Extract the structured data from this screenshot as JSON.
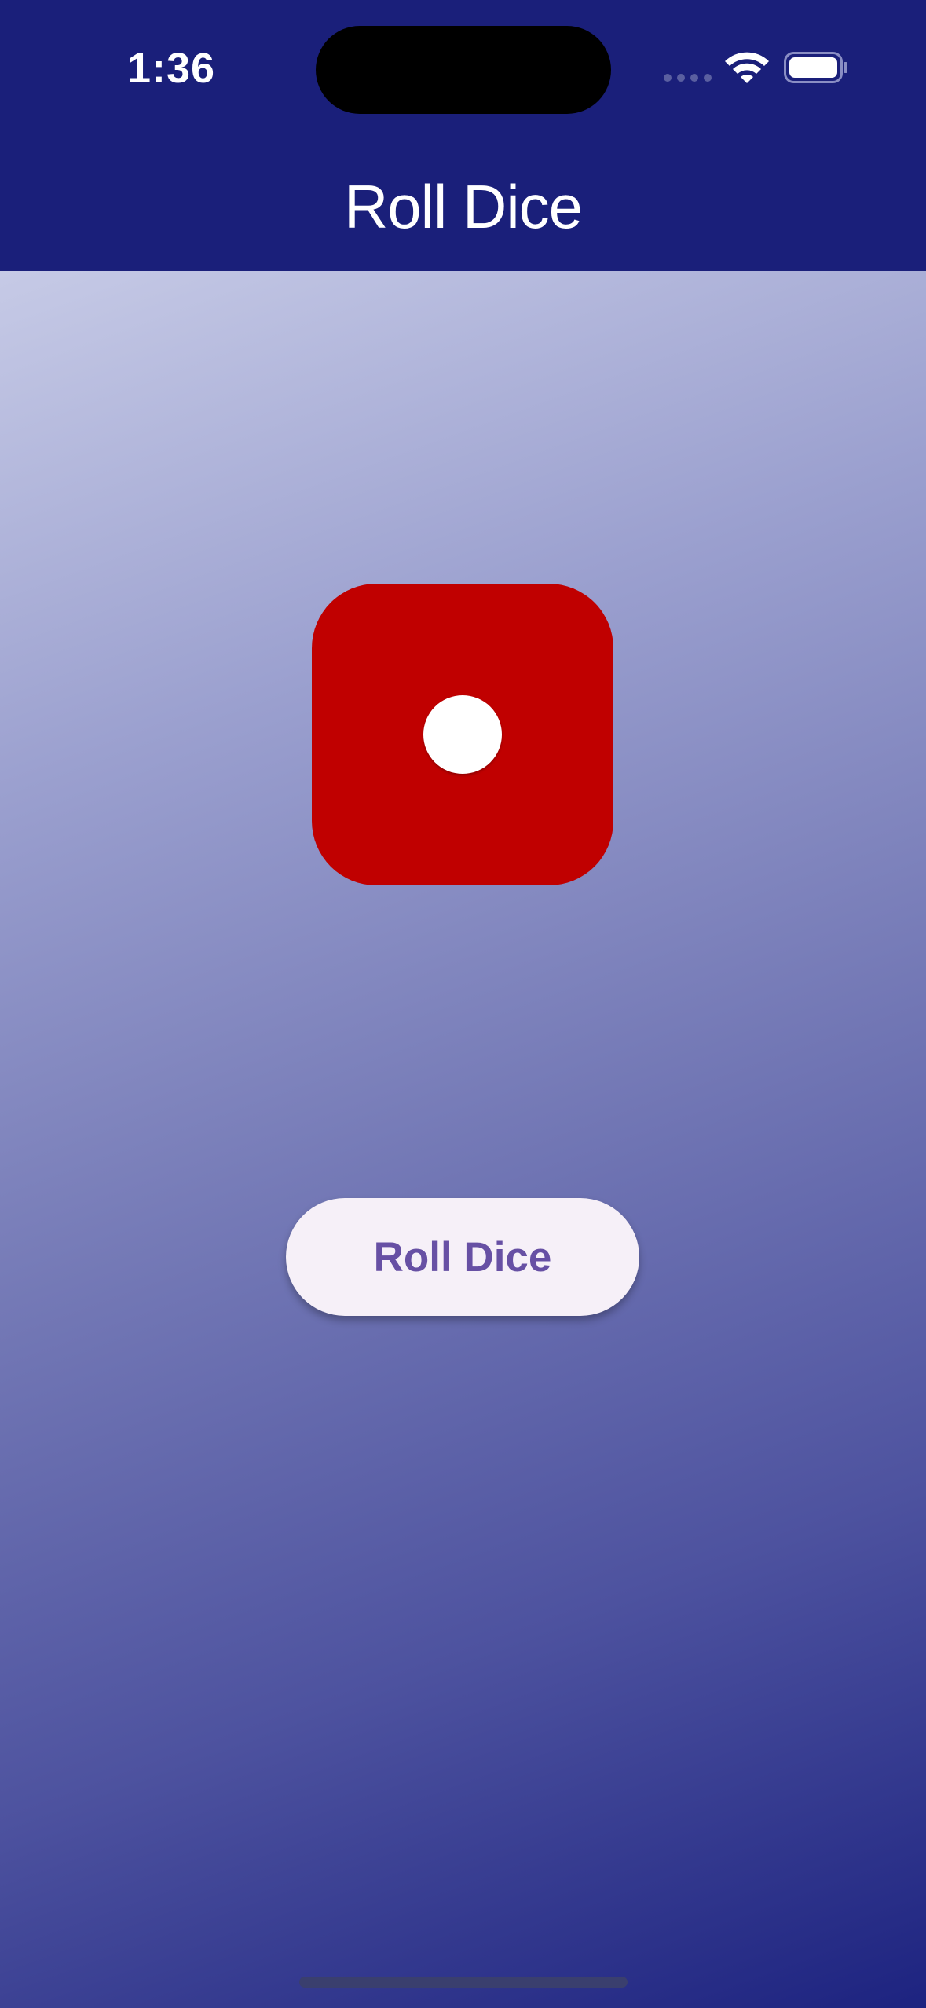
{
  "status_bar": {
    "time": "1:36",
    "icons": [
      "cellular-signal-icon",
      "wifi-icon",
      "battery-icon"
    ]
  },
  "app_bar": {
    "title": "Roll Dice"
  },
  "dice": {
    "face_value": 1,
    "color": "#c00000",
    "pip_color": "#ffffff"
  },
  "roll_button": {
    "label": "Roll Dice"
  },
  "colors": {
    "app_bar": "#1a1f7a",
    "gradient_start": "#c6cae6",
    "gradient_end": "#1d2380",
    "button_background": "#f6f0f8",
    "button_text": "#6750a4"
  }
}
